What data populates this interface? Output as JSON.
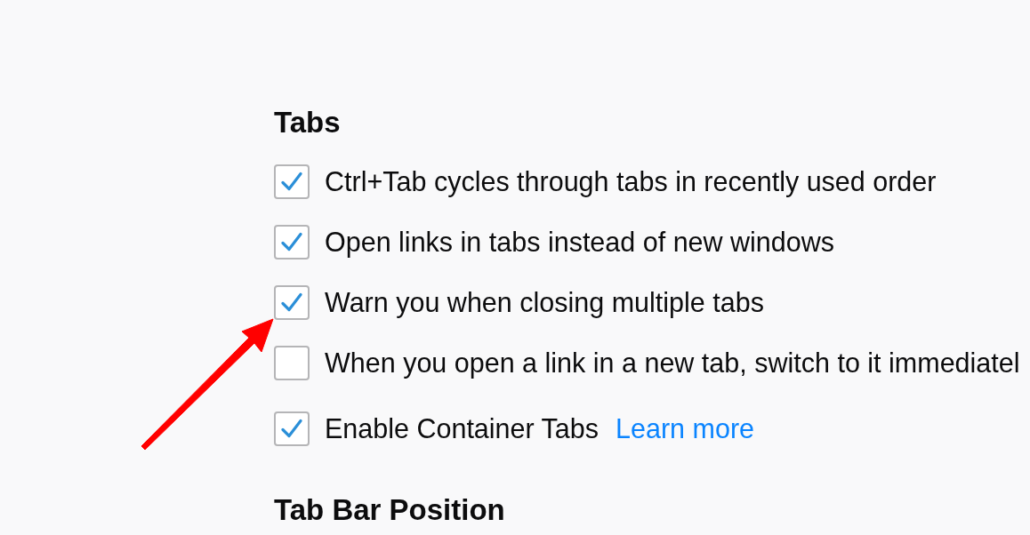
{
  "sections": [
    {
      "heading": "Tabs",
      "options": [
        {
          "label": "Ctrl+Tab cycles through tabs in recently used order",
          "checked": true
        },
        {
          "label": "Open links in tabs instead of new windows",
          "checked": true
        },
        {
          "label": "Warn you when closing multiple tabs",
          "checked": true
        },
        {
          "label": "When you open a link in a new tab, switch to it immediatel",
          "checked": false
        },
        {
          "label": "Enable Container Tabs",
          "checked": true,
          "link": "Learn more"
        }
      ]
    },
    {
      "heading": "Tab Bar Position"
    }
  ]
}
